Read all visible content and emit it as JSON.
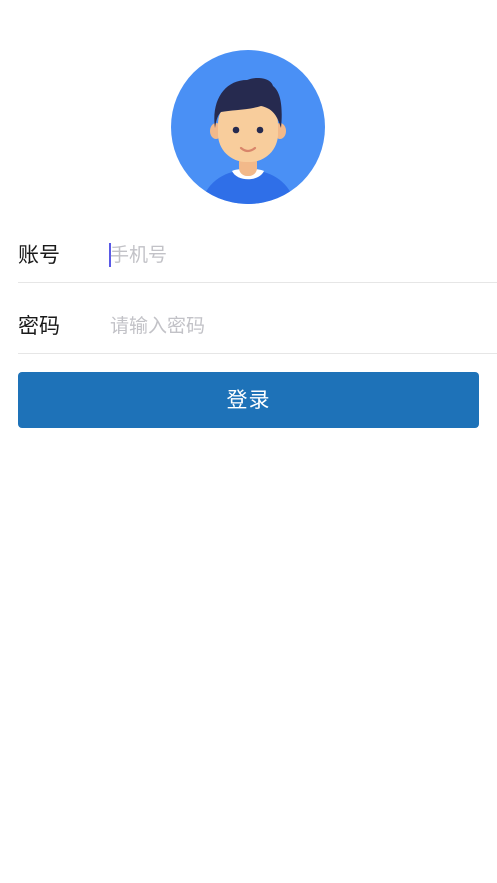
{
  "avatar": {
    "icon": "user-avatar-icon",
    "colors": {
      "background": "#4a90f5",
      "hair": "#262a4f",
      "skin": "#f8cd9c",
      "shirt": "#2f6fe8"
    }
  },
  "form": {
    "account": {
      "label": "账号",
      "placeholder": "手机号",
      "value": ""
    },
    "password": {
      "label": "密码",
      "placeholder": "请输入密码",
      "value": ""
    }
  },
  "login_button": {
    "label": "登录",
    "color": "#1e72b8"
  }
}
